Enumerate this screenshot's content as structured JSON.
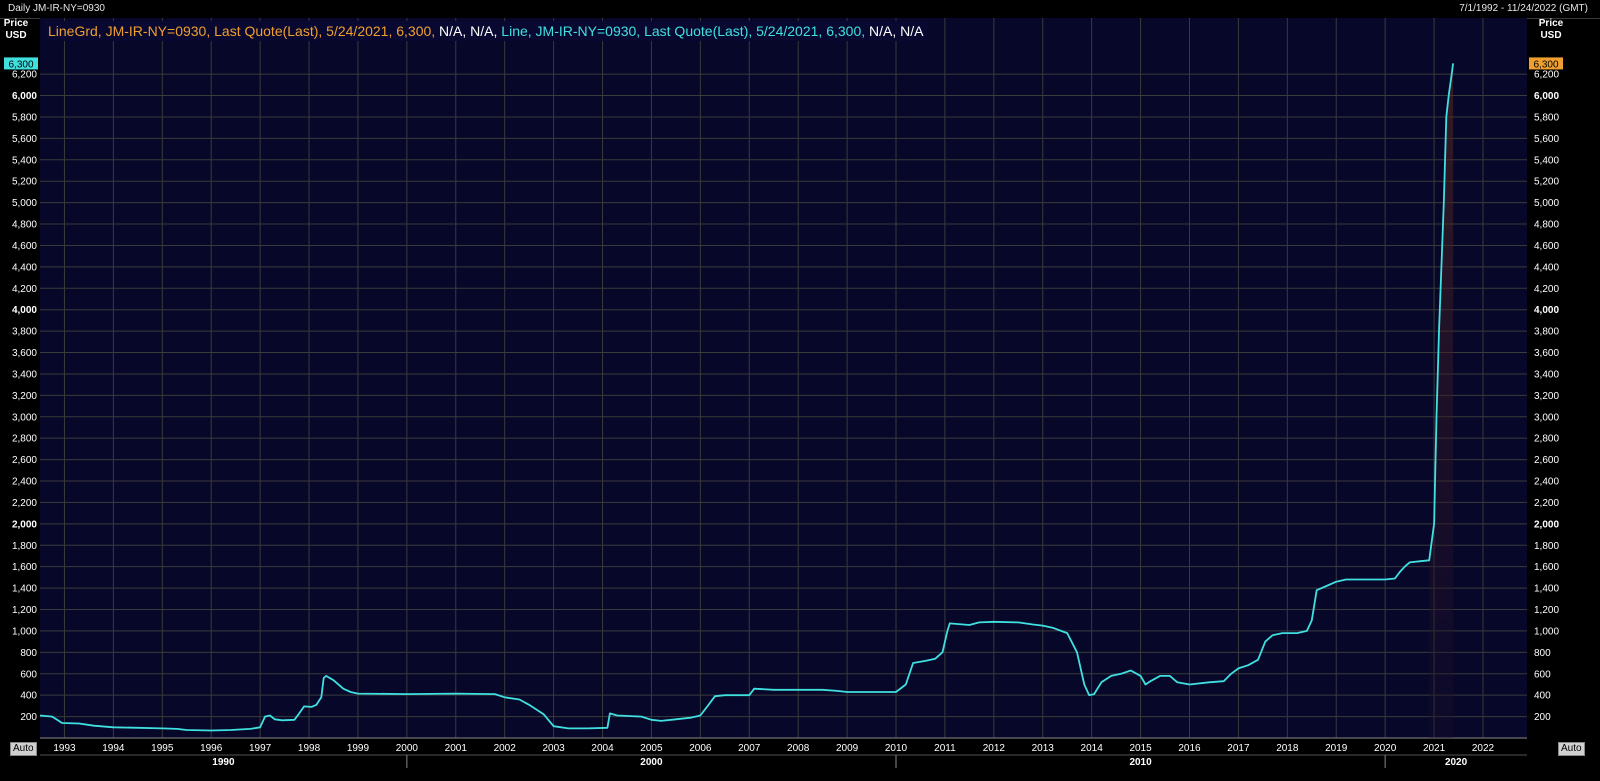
{
  "header": {
    "title": "Daily JM-IR-NY=0930",
    "date_range": "7/1/1992 - 11/24/2022 (GMT)"
  },
  "legend": {
    "series1_name": "LineGrd, JM-IR-NY=0930, Last Quote(Last), 5/24/2021, 6,300,",
    "series1_tail": " N/A, N/A, ",
    "series2_name": "Line, JM-IR-NY=0930, Last Quote(Last), 5/24/2021, 6,300,",
    "series2_tail": " N/A, N/A"
  },
  "controls": {
    "auto_left": "Auto",
    "auto_right": "Auto"
  },
  "colors": {
    "background": "#07072a",
    "grid": "#3a3a3a",
    "line": "#40e0e0",
    "orange": "#f0a030",
    "cyan_badge": "#40e0e0",
    "text": "#ffffff"
  },
  "chart_data": {
    "type": "line",
    "ylabel_top": "Price",
    "ylabel_unit": "USD",
    "ylim": [
      0,
      6500
    ],
    "y_ticks": [
      200,
      400,
      600,
      800,
      1000,
      1200,
      1400,
      1600,
      1800,
      2000,
      2200,
      2400,
      2600,
      2800,
      3000,
      3200,
      3400,
      3600,
      3800,
      4000,
      4200,
      4400,
      4600,
      4800,
      5000,
      5200,
      5400,
      5600,
      5800,
      6000,
      6200
    ],
    "y_tick_labels": [
      "200",
      "400",
      "600",
      "800",
      "1,000",
      "1,200",
      "1,400",
      "1,600",
      "1,800",
      "2,000",
      "2,200",
      "2,400",
      "2,600",
      "2,800",
      "3,000",
      "3,200",
      "3,400",
      "3,600",
      "3,800",
      "4,000",
      "4,200",
      "4,400",
      "4,600",
      "4,800",
      "5,000",
      "5,200",
      "5,400",
      "5,600",
      "5,800",
      "6,000",
      "6,200"
    ],
    "y_bold_ticks": [
      "2,000",
      "4,000",
      "6,000"
    ],
    "last_value_label": "6,300",
    "xlim": [
      1992.5,
      2022.9
    ],
    "x_ticks": [
      1993,
      1994,
      1995,
      1996,
      1997,
      1998,
      1999,
      2000,
      2001,
      2002,
      2003,
      2004,
      2005,
      2006,
      2007,
      2008,
      2009,
      2010,
      2011,
      2012,
      2013,
      2014,
      2015,
      2016,
      2017,
      2018,
      2019,
      2020,
      2021,
      2022
    ],
    "x_tick_labels": [
      "1993",
      "1994",
      "1995",
      "1996",
      "1997",
      "1998",
      "1999",
      "2000",
      "2001",
      "2002",
      "2003",
      "2004",
      "2005",
      "2006",
      "2007",
      "2008",
      "2009",
      "2010",
      "2011",
      "2012",
      "2013",
      "2014",
      "2015",
      "2016",
      "2017",
      "2018",
      "2019",
      "2020",
      "2021",
      "2022"
    ],
    "decade_labels": [
      {
        "label": "1990",
        "start": 1992.5,
        "end": 2000
      },
      {
        "label": "2000",
        "start": 2000,
        "end": 2010
      },
      {
        "label": "2010",
        "start": 2010,
        "end": 2020
      },
      {
        "label": "2020",
        "start": 2020,
        "end": 2022.9
      }
    ],
    "series": [
      {
        "points": [
          [
            1992.5,
            210
          ],
          [
            1992.75,
            200
          ],
          [
            1992.85,
            170
          ],
          [
            1992.95,
            140
          ],
          [
            1993.3,
            135
          ],
          [
            1993.6,
            115
          ],
          [
            1994.0,
            100
          ],
          [
            1994.5,
            95
          ],
          [
            1995.0,
            90
          ],
          [
            1995.3,
            85
          ],
          [
            1995.5,
            75
          ],
          [
            1996.0,
            70
          ],
          [
            1996.4,
            75
          ],
          [
            1996.8,
            85
          ],
          [
            1997.0,
            100
          ],
          [
            1997.05,
            150
          ],
          [
            1997.1,
            200
          ],
          [
            1997.2,
            210
          ],
          [
            1997.3,
            175
          ],
          [
            1997.45,
            165
          ],
          [
            1997.7,
            170
          ],
          [
            1997.8,
            230
          ],
          [
            1997.9,
            295
          ],
          [
            1998.05,
            290
          ],
          [
            1998.15,
            310
          ],
          [
            1998.25,
            380
          ],
          [
            1998.3,
            560
          ],
          [
            1998.35,
            580
          ],
          [
            1998.5,
            540
          ],
          [
            1998.7,
            460
          ],
          [
            1998.85,
            430
          ],
          [
            1999.0,
            415
          ],
          [
            2000.0,
            410
          ],
          [
            2001.0,
            415
          ],
          [
            2001.8,
            410
          ],
          [
            2002.0,
            380
          ],
          [
            2002.3,
            360
          ],
          [
            2002.5,
            310
          ],
          [
            2002.8,
            220
          ],
          [
            2003.0,
            110
          ],
          [
            2003.3,
            90
          ],
          [
            2003.7,
            90
          ],
          [
            2004.1,
            95
          ],
          [
            2004.15,
            230
          ],
          [
            2004.3,
            210
          ],
          [
            2004.8,
            200
          ],
          [
            2005.0,
            170
          ],
          [
            2005.2,
            160
          ],
          [
            2005.5,
            175
          ],
          [
            2005.8,
            190
          ],
          [
            2006.0,
            210
          ],
          [
            2006.15,
            300
          ],
          [
            2006.3,
            390
          ],
          [
            2006.5,
            400
          ],
          [
            2007.0,
            400
          ],
          [
            2007.1,
            460
          ],
          [
            2007.5,
            450
          ],
          [
            2008.0,
            450
          ],
          [
            2008.5,
            450
          ],
          [
            2008.8,
            440
          ],
          [
            2009.0,
            430
          ],
          [
            2009.5,
            430
          ],
          [
            2010.0,
            430
          ],
          [
            2010.2,
            500
          ],
          [
            2010.35,
            700
          ],
          [
            2010.6,
            720
          ],
          [
            2010.8,
            740
          ],
          [
            2010.95,
            800
          ],
          [
            2011.05,
            1000
          ],
          [
            2011.1,
            1070
          ],
          [
            2011.5,
            1055
          ],
          [
            2011.7,
            1080
          ],
          [
            2012.0,
            1085
          ],
          [
            2012.5,
            1080
          ],
          [
            2012.8,
            1060
          ],
          [
            2013.0,
            1050
          ],
          [
            2013.2,
            1030
          ],
          [
            2013.5,
            980
          ],
          [
            2013.7,
            800
          ],
          [
            2013.85,
            500
          ],
          [
            2013.95,
            400
          ],
          [
            2014.05,
            410
          ],
          [
            2014.2,
            520
          ],
          [
            2014.4,
            580
          ],
          [
            2014.6,
            600
          ],
          [
            2014.8,
            630
          ],
          [
            2015.0,
            580
          ],
          [
            2015.1,
            500
          ],
          [
            2015.2,
            530
          ],
          [
            2015.4,
            580
          ],
          [
            2015.6,
            580
          ],
          [
            2015.75,
            520
          ],
          [
            2016.0,
            500
          ],
          [
            2016.4,
            520
          ],
          [
            2016.7,
            530
          ],
          [
            2016.85,
            600
          ],
          [
            2017.0,
            650
          ],
          [
            2017.2,
            680
          ],
          [
            2017.4,
            730
          ],
          [
            2017.55,
            900
          ],
          [
            2017.7,
            960
          ],
          [
            2017.9,
            980
          ],
          [
            2018.2,
            980
          ],
          [
            2018.4,
            1000
          ],
          [
            2018.5,
            1100
          ],
          [
            2018.6,
            1380
          ],
          [
            2018.8,
            1420
          ],
          [
            2019.0,
            1460
          ],
          [
            2019.2,
            1480
          ],
          [
            2019.5,
            1480
          ],
          [
            2020.0,
            1480
          ],
          [
            2020.2,
            1490
          ],
          [
            2020.3,
            1550
          ],
          [
            2020.4,
            1600
          ],
          [
            2020.5,
            1640
          ],
          [
            2020.7,
            1650
          ],
          [
            2020.9,
            1660
          ],
          [
            2021.0,
            2000
          ],
          [
            2021.05,
            3000
          ],
          [
            2021.1,
            3800
          ],
          [
            2021.15,
            4400
          ],
          [
            2021.2,
            5000
          ],
          [
            2021.25,
            5800
          ],
          [
            2021.3,
            6000
          ],
          [
            2021.33,
            6100
          ],
          [
            2021.36,
            6200
          ],
          [
            2021.39,
            6300
          ]
        ]
      }
    ],
    "grid": true
  }
}
